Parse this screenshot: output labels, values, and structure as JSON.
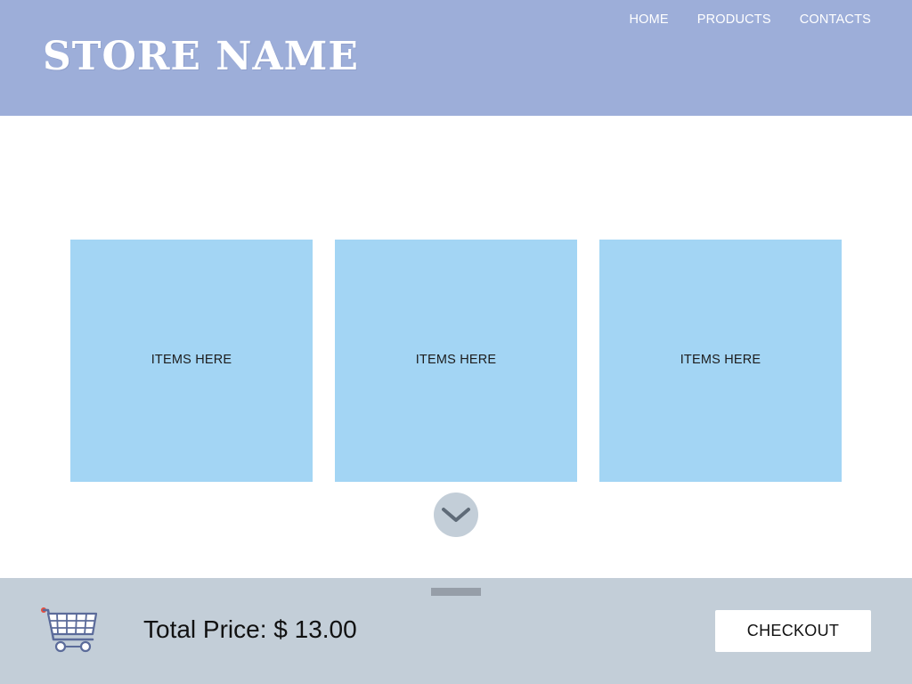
{
  "header": {
    "store_name": "STORE NAME",
    "nav": [
      "HOME",
      "PRODUCTS",
      "CONTACTS"
    ]
  },
  "items": [
    {
      "label": "ITEMS HERE"
    },
    {
      "label": "ITEMS HERE"
    },
    {
      "label": "ITEMS HERE"
    }
  ],
  "scroll_icon": "chevron-down-icon",
  "footer": {
    "cart_icon": "shopping-cart-icon",
    "total_label": "Total Price:",
    "total_value": "$ 13.00",
    "checkout_label": "CHECKOUT"
  },
  "colors": {
    "header_bg": "#9daed9",
    "tile_bg": "#a3d5f4",
    "footer_bg": "#c3ced8",
    "accent": "#e74c3c"
  }
}
